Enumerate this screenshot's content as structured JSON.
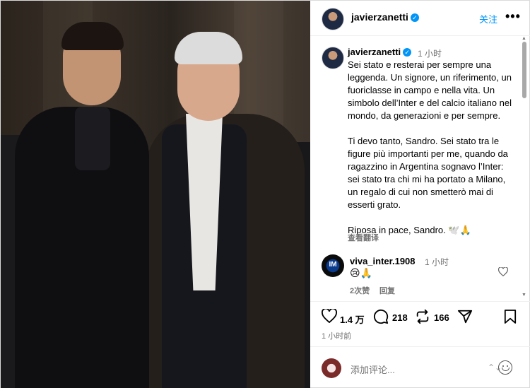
{
  "header": {
    "username": "javierzanetti",
    "verified_badge": "✓",
    "follow_label": "关注",
    "more_label": "•••"
  },
  "post": {
    "author": "javierzanetti",
    "verified_badge": "✓",
    "time": "1 小时",
    "caption": "Sei stato e resterai per sempre una leggenda. Un signore, un riferimento, un fuoriclasse in campo e nella vita. Un simbolo dell’Inter e del calcio italiano nel mondo, da generazioni e per sempre.\n\nTi devo tanto, Sandro. Sei stato tra le figure più importanti per me, quando da ragazzino in Argentina sognavo l’Inter: sei stato tra chi mi ha portato a Milano, un regalo di cui non smetterò mai di esserti grato.\n\nRiposa in pace, Sandro. 🕊️🙏",
    "translate_label": "查看翻译"
  },
  "comment": {
    "author": "viva_inter.1908",
    "avatar_text": "IM",
    "time": "1 小时",
    "text": "😢🙏",
    "likes_label": "2次赞",
    "reply_label": "回复"
  },
  "actions": {
    "likes_count": "1.4 万",
    "comments_count": "218",
    "reposts_count": "166",
    "time_ago": "1 小时前"
  },
  "composer": {
    "placeholder": "添加评论...",
    "expand_label": "⌃⌄"
  },
  "colors": {
    "accent": "#0095f6",
    "muted": "#737373",
    "border": "#dbdbdb"
  },
  "icons": [
    "verified-icon",
    "more-icon",
    "heart-icon",
    "comment-icon",
    "repost-icon",
    "share-icon",
    "bookmark-icon",
    "emoji-icon"
  ]
}
